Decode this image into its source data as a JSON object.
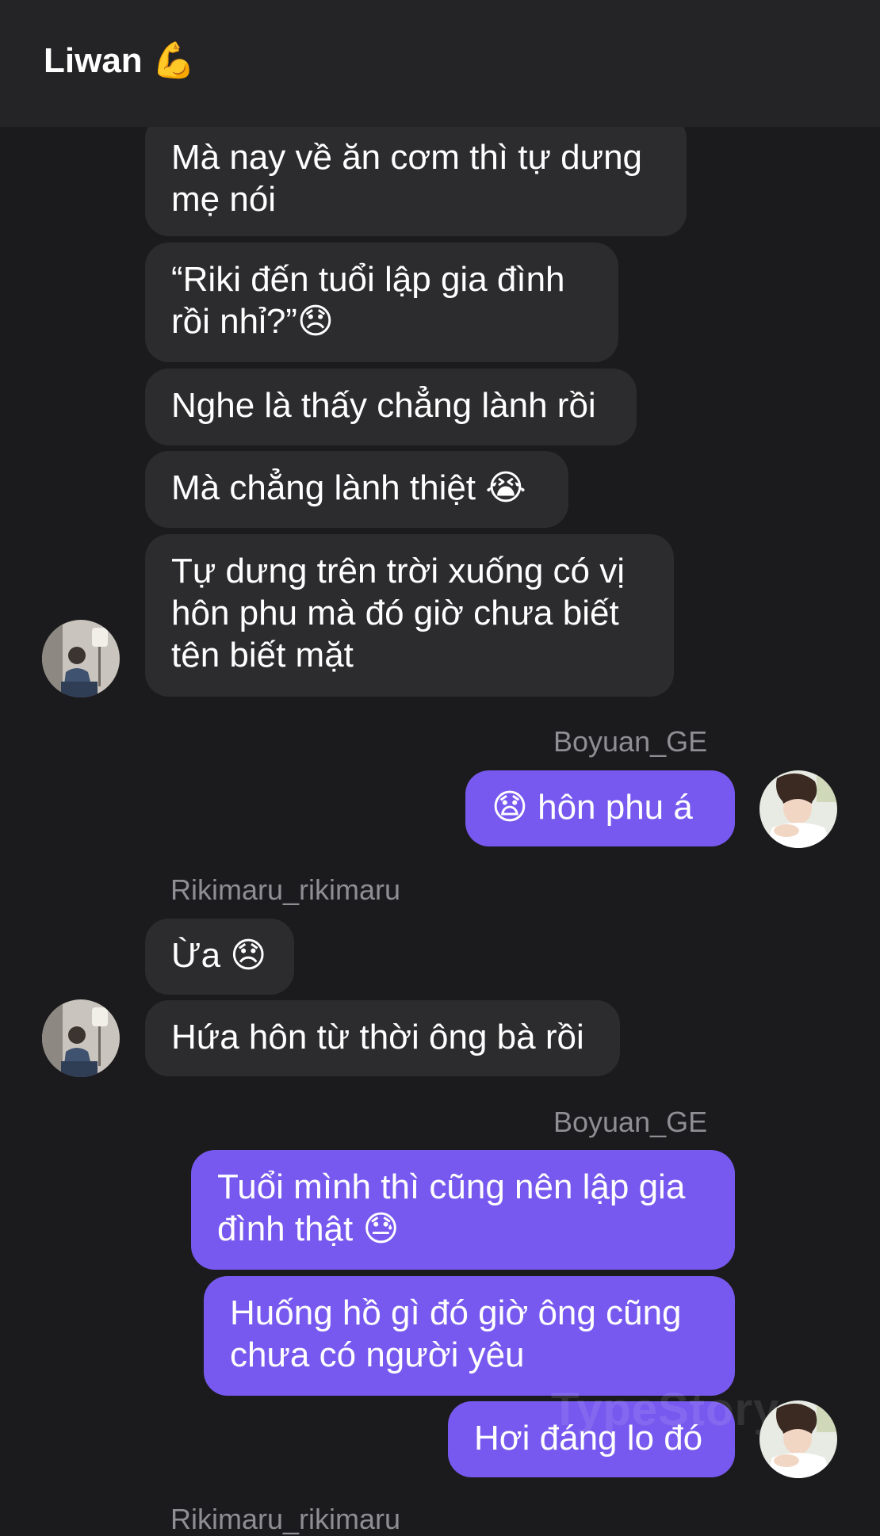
{
  "header": {
    "title": "Liwan",
    "title_emoji": "💪"
  },
  "messages": [
    {
      "lines": [
        "Mà nay về ăn cơm thì tự dưng",
        "mẹ nói"
      ]
    },
    {
      "lines": [
        "“Riki đến tuổi lập gia đình",
        "rồi nhỉ?”😞"
      ]
    },
    {
      "lines": [
        "Nghe là thấy chẳng lành rồi"
      ]
    },
    {
      "lines": [
        "Mà chẳng lành thiệt 😭"
      ]
    },
    {
      "lines": [
        "Tự dưng trên trời xuống có vị",
        "hôn phu mà đó giờ chưa biết",
        "tên biết mặt"
      ]
    },
    {
      "sender": "Boyuan_GE",
      "lines": [
        "😧 hôn phu á"
      ]
    },
    {
      "sender": "Rikimaru_rikimaru",
      "lines": [
        "Ừa 😞"
      ]
    },
    {
      "lines": [
        "Hứa hôn từ thời ông bà rồi"
      ]
    },
    {
      "sender": "Boyuan_GE",
      "lines": [
        "Tuổi mình thì cũng nên lập gia",
        "đình thật 😓"
      ]
    },
    {
      "lines": [
        "Huống hồ gì đó giờ ông cũng",
        "chưa có người yêu"
      ]
    },
    {
      "lines": [
        "Hơi đáng lo đó"
      ]
    },
    {
      "sender": "Rikimaru_rikimaru"
    }
  ],
  "watermark": "TypeStory",
  "colors": {
    "background": "#1b1b1d",
    "header": "#242426",
    "incoming_bubble": "#2c2c2e",
    "outgoing_bubble": "#7759ef",
    "sender_name": "#8e8e93"
  },
  "icons": {
    "title_emoji": "flexed-biceps-icon",
    "avatar_rikimaru": "avatar-photo-rikimaru",
    "avatar_boyuan": "avatar-photo-boyuan"
  }
}
